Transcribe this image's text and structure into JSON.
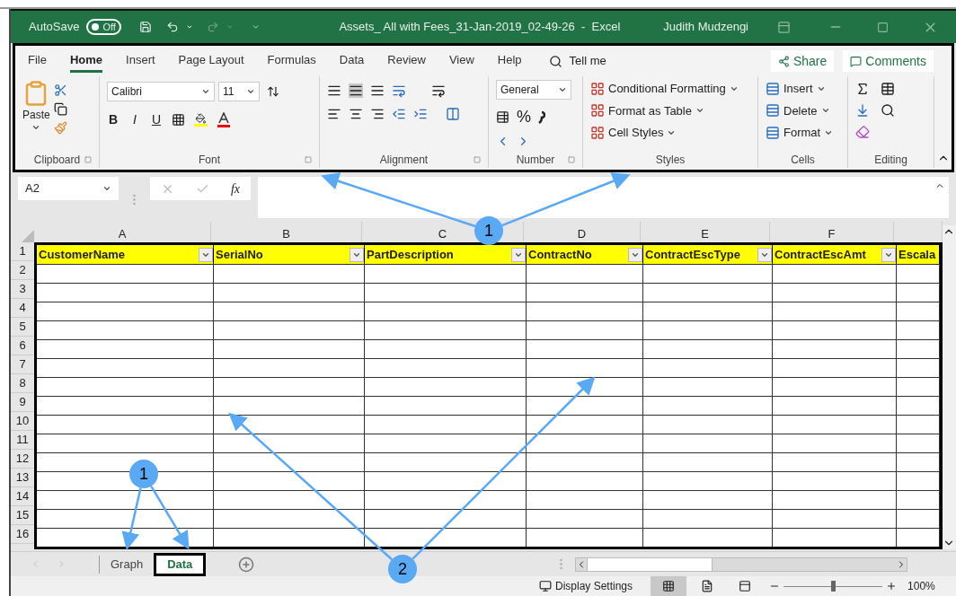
{
  "title_bar": {
    "autosave_label": "AutoSave",
    "autosave": {
      "label": "Off",
      "on": false
    },
    "title": "Assets_ All with Fees_31-Jan-2019_02-49-26  -  Excel",
    "user": "Judith Mudzengi"
  },
  "ribbon": {
    "tabs": [
      {
        "label": "File",
        "selected": false
      },
      {
        "label": "Home",
        "selected": true
      },
      {
        "label": "Insert",
        "selected": false
      },
      {
        "label": "Page Layout",
        "selected": false
      },
      {
        "label": "Formulas",
        "selected": false
      },
      {
        "label": "Data",
        "selected": false
      },
      {
        "label": "Review",
        "selected": false
      },
      {
        "label": "View",
        "selected": false
      },
      {
        "label": "Help",
        "selected": false
      }
    ],
    "tell_me": "Tell me",
    "share": "Share",
    "comments": "Comments",
    "clipboard": {
      "label": "Clipboard",
      "paste": "Paste"
    },
    "font": {
      "label": "Font",
      "font_name": "Calibri",
      "font_size": "11",
      "bold": "B",
      "italic": "I",
      "underline": "U"
    },
    "alignment": {
      "label": "Alignment"
    },
    "number": {
      "label": "Number",
      "format": "General",
      "percent": "%"
    },
    "styles": {
      "label": "Styles",
      "items": [
        "Conditional Formatting",
        "Format as Table",
        "Cell Styles"
      ]
    },
    "cells": {
      "label": "Cells",
      "items": [
        "Insert",
        "Delete",
        "Format"
      ]
    },
    "editing": {
      "label": "Editing"
    }
  },
  "formula_bar": {
    "name_box": "A2",
    "fx": "fx"
  },
  "sheet": {
    "columns": [
      "A",
      "B",
      "C",
      "D",
      "E",
      "F",
      ""
    ],
    "headers": [
      {
        "text": "CustomerName",
        "filter": true
      },
      {
        "text": "SerialNo",
        "filter": true
      },
      {
        "text": "PartDescription",
        "filter": true
      },
      {
        "text": "ContractNo",
        "filter": true
      },
      {
        "text": "ContractEscType",
        "filter": true
      },
      {
        "text": "ContractEscAmt",
        "filter": true
      },
      {
        "text": "Escala",
        "filter": false
      }
    ],
    "row_numbers": [
      "1",
      "2",
      "3",
      "4",
      "5",
      "6",
      "7",
      "8",
      "9",
      "10",
      "11",
      "12",
      "13",
      "14",
      "15",
      "16"
    ]
  },
  "sheet_tabs": [
    {
      "label": "Graph",
      "selected": false
    },
    {
      "label": "Data",
      "selected": true
    }
  ],
  "status_bar": {
    "display_settings": "Display Settings",
    "zoom": {
      "level": 0.5
    },
    "zoom_reading": "100%"
  },
  "callouts": [
    {
      "label": "1"
    },
    {
      "label": "1"
    },
    {
      "label": "2"
    }
  ]
}
